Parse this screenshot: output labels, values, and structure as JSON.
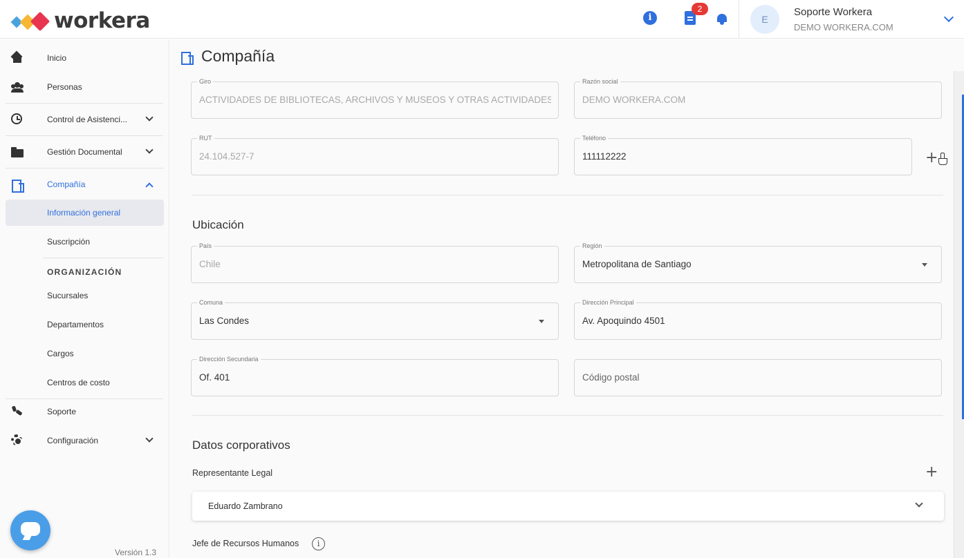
{
  "header": {
    "logo_text": "workera",
    "notifications_badge": "2",
    "user": {
      "initial": "E",
      "name": "Soporte Workera",
      "company": "DEMO WORKERA.COM"
    }
  },
  "sidebar": {
    "items": [
      {
        "label": "Inicio",
        "icon": "home-icon"
      },
      {
        "label": "Personas",
        "icon": "people-icon"
      },
      {
        "label": "Control de Asistenci...",
        "icon": "alarm-clock-icon"
      },
      {
        "label": "Gestión Documental",
        "icon": "folder-icon"
      },
      {
        "label": "Compañía",
        "icon": "building-icon"
      },
      {
        "label": "Información general"
      },
      {
        "label": "Suscripción"
      },
      {
        "label": "Sucursales"
      },
      {
        "label": "Departamentos"
      },
      {
        "label": "Cargos"
      },
      {
        "label": "Centros de costo"
      },
      {
        "label": "Soporte",
        "icon": "phone-icon"
      },
      {
        "label": "Configuración",
        "icon": "gear-icon"
      }
    ],
    "section_organizacion": "ORGANIZACIÓN",
    "version": "Versión 1.3"
  },
  "page": {
    "title": "Compañía",
    "fields": {
      "giro": {
        "label": "Giro",
        "value": "ACTIVIDADES DE BIBLIOTECAS, ARCHIVOS Y MUSEOS Y OTRAS ACTIVIDADES CUL"
      },
      "razon_social": {
        "label": "Razón social",
        "value": "DEMO WORKERA.COM"
      },
      "rut": {
        "label": "RUT",
        "value": "24.104.527-7"
      },
      "telefono": {
        "label": "Teléfono",
        "value": "111112222"
      },
      "pais": {
        "label": "País",
        "value": "Chile"
      },
      "region": {
        "label": "Región",
        "value": "Metropolitana de Santiago"
      },
      "comuna": {
        "label": "Comuna",
        "value": "Las Condes"
      },
      "direccion_principal": {
        "label": "Dirección Principal",
        "value": "Av. Apoquindo 4501"
      },
      "direccion_secundaria": {
        "label": "Dirección Secundaria",
        "value": "Of. 401"
      },
      "codigo_postal": {
        "placeholder": "Código postal"
      }
    },
    "section_ubicacion": "Ubicación",
    "section_datos": "Datos corporativos",
    "representante_label": "Representante Legal",
    "representante_name": "Eduardo Zambrano",
    "jefe_rrhh_label": "Jefe de Recursos Humanos"
  },
  "colors": {
    "accent": "#2f6fde",
    "badge": "#e53935",
    "chat": "#4a9ee8"
  }
}
